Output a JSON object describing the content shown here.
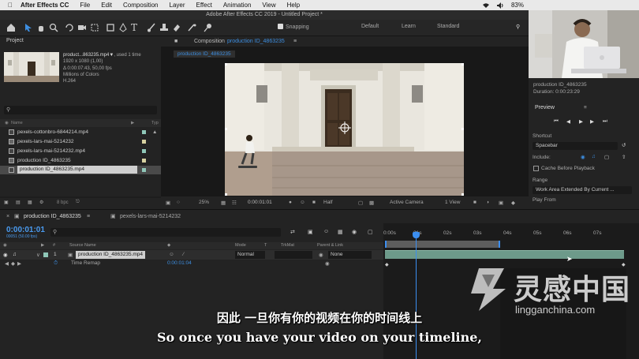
{
  "menubar": {
    "app": "After Effects CC",
    "items": [
      "File",
      "Edit",
      "Composition",
      "Layer",
      "Effect",
      "Animation",
      "View",
      "Help"
    ],
    "battery": "83%"
  },
  "window_title": "Adobe After Effects CC 2019 - Untitled Project *",
  "toolbar": {
    "snapping": "Snapping",
    "workspaces": [
      "Default",
      "Learn",
      "Standard"
    ]
  },
  "project": {
    "tab": "Project",
    "selected_name": "product...863235.mp4▼",
    "used": ", used 1 time",
    "info": [
      "1920 x 1080 (1,00)",
      "Δ 0:00:07:43, 50,00 fps",
      "Millions of Colors",
      "H.264"
    ],
    "columns": [
      "Name",
      "Typ"
    ],
    "items": [
      {
        "name": "pexels-cottonbro-6844214.mp4",
        "color": "#8fc7b8",
        "kind": "file"
      },
      {
        "name": "pexels-lars-mai-5214232",
        "color": "#d6d0a0",
        "kind": "comp"
      },
      {
        "name": "pexels-lars-mai-5214232.mp4",
        "color": "#8fc7b8",
        "kind": "file"
      },
      {
        "name": "production ID_4863235",
        "color": "#d6d0a0",
        "kind": "comp"
      },
      {
        "name": "production ID_4863235.mp4",
        "color": "#8fc7b8",
        "kind": "file"
      }
    ],
    "bpc": "8 bpc"
  },
  "composition": {
    "tab_prefix": "Composition",
    "tab_name": "production ID_4863235",
    "subtab": "production ID_4863235",
    "zoom": "25%",
    "timecode": "0:00:01:01",
    "resolution": "Half",
    "camera": "Active Camera",
    "views": "1 View"
  },
  "clipinfo": {
    "name": "production ID_4863235",
    "duration": "Duration: 0:00:23:29"
  },
  "preview": {
    "title": "Preview",
    "shortcut_label": "Shortcut",
    "shortcut_value": "Spacebar",
    "include_label": "Include:",
    "cache_label": "Cache Before Playback",
    "range_label": "Range",
    "range_value": "Work Area Extended By Current ...",
    "play_from": "Play From"
  },
  "timeline": {
    "tabs": [
      "production ID_4863235",
      "pexels-lars-mai-5214232"
    ],
    "timecode": "0:00:01:01",
    "fps": "00051 (50.00 fps)",
    "columns": [
      "#",
      "Source Name",
      "Mode",
      "T",
      "TrkMat",
      "Parent & Link"
    ],
    "layer": {
      "index": "1",
      "name": "production ID_4863235.mp4",
      "mode": "Normal",
      "parent": "None"
    },
    "sub_property": {
      "name": "Time Remap",
      "value": "0:00:01:04"
    },
    "ruler": [
      "0:00s",
      "01s",
      "02s",
      "03s",
      "04s",
      "05s",
      "06s",
      "07s"
    ]
  },
  "subtitles": {
    "cn": "因此 一旦你有你的视频在你的时间线上",
    "en": "So once you have your video on your timeline,"
  },
  "watermark": {
    "cn": "灵感中国",
    "url": "lingganchina.com"
  }
}
